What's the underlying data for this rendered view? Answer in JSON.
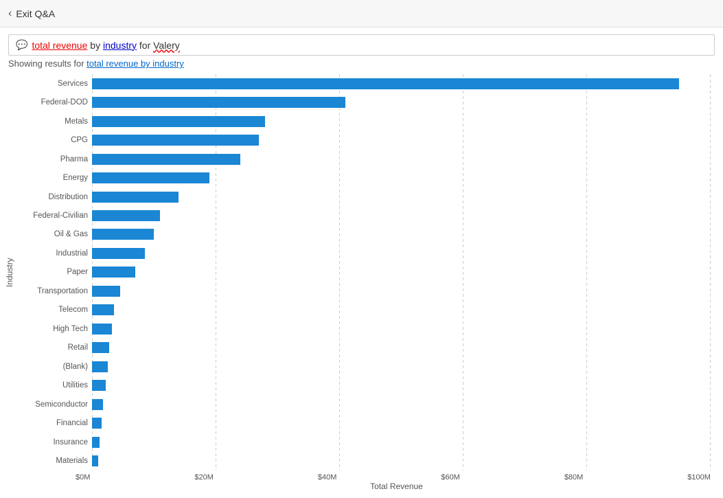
{
  "header": {
    "back_label": "Exit Q&A"
  },
  "search": {
    "query_part1": "total revenue",
    "query_part2": "by",
    "query_part3": "industry",
    "query_part4": "for",
    "query_part5": "Valery"
  },
  "results": {
    "prefix": "Showing results for ",
    "link_text": "total revenue by industry"
  },
  "chart": {
    "y_axis_label": "Industry",
    "x_axis_label": "Total Revenue",
    "x_ticks": [
      "$0M",
      "$20M",
      "$40M",
      "$60M",
      "$80M",
      "$100M"
    ],
    "max_value": 100,
    "bars": [
      {
        "label": "Services",
        "value": 95
      },
      {
        "label": "Federal-DOD",
        "value": 41
      },
      {
        "label": "Metals",
        "value": 28
      },
      {
        "label": "CPG",
        "value": 27
      },
      {
        "label": "Pharma",
        "value": 24
      },
      {
        "label": "Energy",
        "value": 19
      },
      {
        "label": "Distribution",
        "value": 14
      },
      {
        "label": "Federal-Civilian",
        "value": 11
      },
      {
        "label": "Oil & Gas",
        "value": 10
      },
      {
        "label": "Industrial",
        "value": 8.5
      },
      {
        "label": "Paper",
        "value": 7
      },
      {
        "label": "Transportation",
        "value": 4.5
      },
      {
        "label": "Telecom",
        "value": 3.5
      },
      {
        "label": "High Tech",
        "value": 3.2
      },
      {
        "label": "Retail",
        "value": 2.8
      },
      {
        "label": "(Blank)",
        "value": 2.5
      },
      {
        "label": "Utilities",
        "value": 2.2
      },
      {
        "label": "Semiconductor",
        "value": 1.8
      },
      {
        "label": "Financial",
        "value": 1.5
      },
      {
        "label": "Insurance",
        "value": 1.2
      },
      {
        "label": "Materials",
        "value": 1.0
      }
    ]
  }
}
